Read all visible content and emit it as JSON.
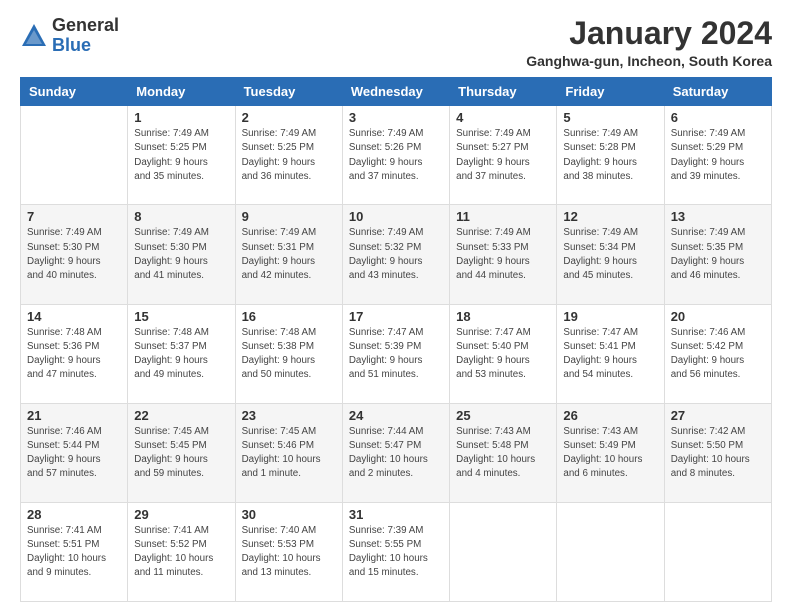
{
  "header": {
    "logo_general": "General",
    "logo_blue": "Blue",
    "title": "January 2024",
    "location": "Ganghwa-gun, Incheon, South Korea"
  },
  "days_of_week": [
    "Sunday",
    "Monday",
    "Tuesday",
    "Wednesday",
    "Thursday",
    "Friday",
    "Saturday"
  ],
  "weeks": [
    [
      {
        "day": "",
        "info": ""
      },
      {
        "day": "1",
        "info": "Sunrise: 7:49 AM\nSunset: 5:25 PM\nDaylight: 9 hours\nand 35 minutes."
      },
      {
        "day": "2",
        "info": "Sunrise: 7:49 AM\nSunset: 5:25 PM\nDaylight: 9 hours\nand 36 minutes."
      },
      {
        "day": "3",
        "info": "Sunrise: 7:49 AM\nSunset: 5:26 PM\nDaylight: 9 hours\nand 37 minutes."
      },
      {
        "day": "4",
        "info": "Sunrise: 7:49 AM\nSunset: 5:27 PM\nDaylight: 9 hours\nand 37 minutes."
      },
      {
        "day": "5",
        "info": "Sunrise: 7:49 AM\nSunset: 5:28 PM\nDaylight: 9 hours\nand 38 minutes."
      },
      {
        "day": "6",
        "info": "Sunrise: 7:49 AM\nSunset: 5:29 PM\nDaylight: 9 hours\nand 39 minutes."
      }
    ],
    [
      {
        "day": "7",
        "info": "Sunrise: 7:49 AM\nSunset: 5:30 PM\nDaylight: 9 hours\nand 40 minutes."
      },
      {
        "day": "8",
        "info": "Sunrise: 7:49 AM\nSunset: 5:30 PM\nDaylight: 9 hours\nand 41 minutes."
      },
      {
        "day": "9",
        "info": "Sunrise: 7:49 AM\nSunset: 5:31 PM\nDaylight: 9 hours\nand 42 minutes."
      },
      {
        "day": "10",
        "info": "Sunrise: 7:49 AM\nSunset: 5:32 PM\nDaylight: 9 hours\nand 43 minutes."
      },
      {
        "day": "11",
        "info": "Sunrise: 7:49 AM\nSunset: 5:33 PM\nDaylight: 9 hours\nand 44 minutes."
      },
      {
        "day": "12",
        "info": "Sunrise: 7:49 AM\nSunset: 5:34 PM\nDaylight: 9 hours\nand 45 minutes."
      },
      {
        "day": "13",
        "info": "Sunrise: 7:49 AM\nSunset: 5:35 PM\nDaylight: 9 hours\nand 46 minutes."
      }
    ],
    [
      {
        "day": "14",
        "info": "Sunrise: 7:48 AM\nSunset: 5:36 PM\nDaylight: 9 hours\nand 47 minutes."
      },
      {
        "day": "15",
        "info": "Sunrise: 7:48 AM\nSunset: 5:37 PM\nDaylight: 9 hours\nand 49 minutes."
      },
      {
        "day": "16",
        "info": "Sunrise: 7:48 AM\nSunset: 5:38 PM\nDaylight: 9 hours\nand 50 minutes."
      },
      {
        "day": "17",
        "info": "Sunrise: 7:47 AM\nSunset: 5:39 PM\nDaylight: 9 hours\nand 51 minutes."
      },
      {
        "day": "18",
        "info": "Sunrise: 7:47 AM\nSunset: 5:40 PM\nDaylight: 9 hours\nand 53 minutes."
      },
      {
        "day": "19",
        "info": "Sunrise: 7:47 AM\nSunset: 5:41 PM\nDaylight: 9 hours\nand 54 minutes."
      },
      {
        "day": "20",
        "info": "Sunrise: 7:46 AM\nSunset: 5:42 PM\nDaylight: 9 hours\nand 56 minutes."
      }
    ],
    [
      {
        "day": "21",
        "info": "Sunrise: 7:46 AM\nSunset: 5:44 PM\nDaylight: 9 hours\nand 57 minutes."
      },
      {
        "day": "22",
        "info": "Sunrise: 7:45 AM\nSunset: 5:45 PM\nDaylight: 9 hours\nand 59 minutes."
      },
      {
        "day": "23",
        "info": "Sunrise: 7:45 AM\nSunset: 5:46 PM\nDaylight: 10 hours\nand 1 minute."
      },
      {
        "day": "24",
        "info": "Sunrise: 7:44 AM\nSunset: 5:47 PM\nDaylight: 10 hours\nand 2 minutes."
      },
      {
        "day": "25",
        "info": "Sunrise: 7:43 AM\nSunset: 5:48 PM\nDaylight: 10 hours\nand 4 minutes."
      },
      {
        "day": "26",
        "info": "Sunrise: 7:43 AM\nSunset: 5:49 PM\nDaylight: 10 hours\nand 6 minutes."
      },
      {
        "day": "27",
        "info": "Sunrise: 7:42 AM\nSunset: 5:50 PM\nDaylight: 10 hours\nand 8 minutes."
      }
    ],
    [
      {
        "day": "28",
        "info": "Sunrise: 7:41 AM\nSunset: 5:51 PM\nDaylight: 10 hours\nand 9 minutes."
      },
      {
        "day": "29",
        "info": "Sunrise: 7:41 AM\nSunset: 5:52 PM\nDaylight: 10 hours\nand 11 minutes."
      },
      {
        "day": "30",
        "info": "Sunrise: 7:40 AM\nSunset: 5:53 PM\nDaylight: 10 hours\nand 13 minutes."
      },
      {
        "day": "31",
        "info": "Sunrise: 7:39 AM\nSunset: 5:55 PM\nDaylight: 10 hours\nand 15 minutes."
      },
      {
        "day": "",
        "info": ""
      },
      {
        "day": "",
        "info": ""
      },
      {
        "day": "",
        "info": ""
      }
    ]
  ]
}
